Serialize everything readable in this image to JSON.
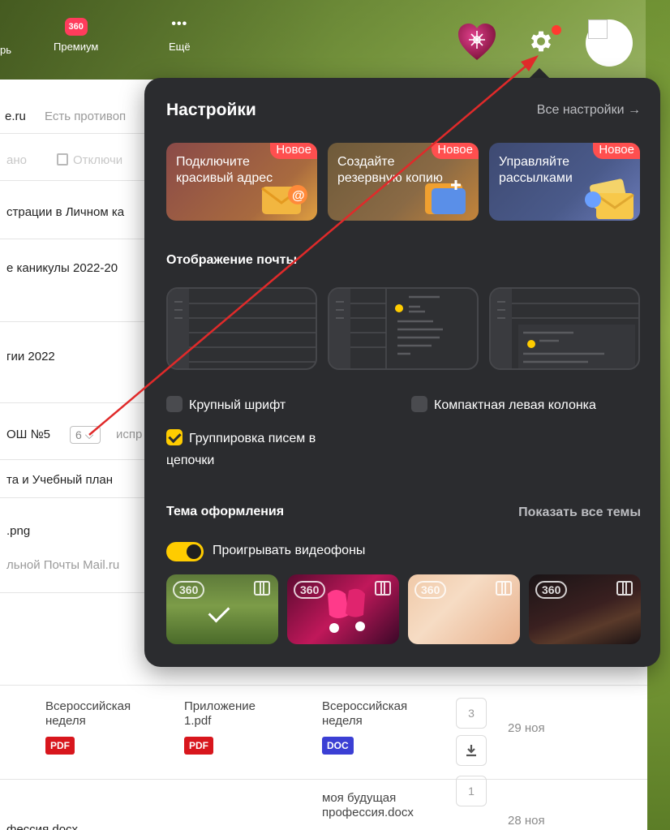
{
  "header": {
    "nav": [
      {
        "label": "рь",
        "icon": "calendar-icon"
      },
      {
        "label": "Премиум",
        "badge": "360",
        "icon": "premium-360-icon"
      },
      {
        "label": "Ещё",
        "icon": "more-dots-icon"
      }
    ]
  },
  "mail_list": {
    "search_domain": "e.ru",
    "search_placeholder": "Есть противоп",
    "toolbar_done": "ано",
    "toolbar_disable": "Отключи",
    "rows": [
      "страции в Личном ка",
      "е каникулы 2022-20",
      "гии 2022",
      "ОШ №5",
      "та и Учебный план",
      ".png",
      "льной Почты Mail.ru",
      "фессия.docx"
    ],
    "thread_count": "6",
    "thread_suffix": "испр",
    "attachments": [
      {
        "name": "Всероссийская неделя",
        "type": "PDF"
      },
      {
        "name": "Приложение 1.pdf",
        "type": "PDF"
      },
      {
        "name": "Всероссийская неделя",
        "type": "DOC"
      },
      {
        "name": "моя будущая профессия.docx",
        "type": ""
      }
    ],
    "counts": [
      "3",
      "1"
    ],
    "dates": [
      "29 ноя",
      "28 ноя"
    ]
  },
  "settings": {
    "title": "Настройки",
    "all_settings": "Все настройки →",
    "promos": [
      {
        "text": "Подключите красивый адрес",
        "badge": "Новое",
        "color": "#8a4a48"
      },
      {
        "text": "Создайте резервную копию",
        "badge": "Новое",
        "color": "#6e5a3a"
      },
      {
        "text": "Управляйте рассылками",
        "badge": "Новое",
        "color": "#4a5a8a"
      }
    ],
    "display_heading": "Отображение почты",
    "options": {
      "large_font": "Крупный шрифт",
      "compact_left": "Компактная левая колонка",
      "grouping_line1": "Группировка писем в",
      "grouping_line2": "цепочки"
    },
    "theme_heading": "Тема оформления",
    "show_all_themes": "Показать все темы",
    "video_toggle": "Проигрывать видеофоны",
    "theme_badge": "360"
  }
}
